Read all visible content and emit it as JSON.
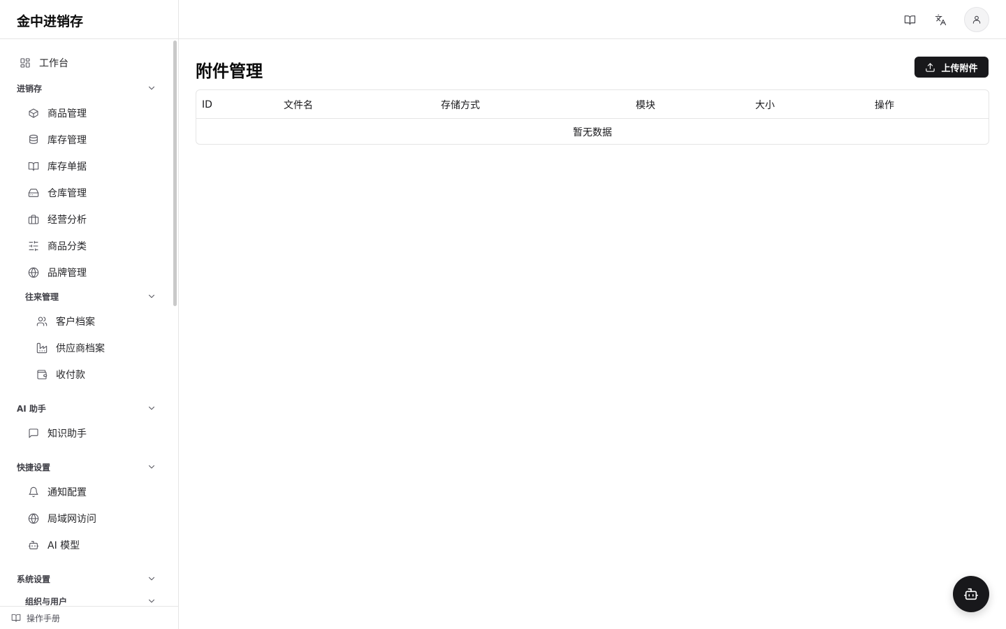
{
  "app": {
    "title": "金中进销存"
  },
  "sidebar": {
    "workbench": {
      "label": "工作台",
      "icon": "dashboard-icon"
    },
    "groups": {
      "jxc": {
        "label": "进销存",
        "items": [
          {
            "label": "商品管理",
            "icon": "package-icon"
          },
          {
            "label": "库存管理",
            "icon": "database-icon"
          },
          {
            "label": "库存单据",
            "icon": "book-open-icon"
          },
          {
            "label": "仓库管理",
            "icon": "warehouse-icon"
          },
          {
            "label": "经营分析",
            "icon": "briefcase-icon"
          },
          {
            "label": "商品分类",
            "icon": "sliders-icon"
          },
          {
            "label": "品牌管理",
            "icon": "globe-icon"
          }
        ],
        "sub": {
          "label": "往来管理",
          "items": [
            {
              "label": "客户档案",
              "icon": "users-icon"
            },
            {
              "label": "供应商档案",
              "icon": "factory-icon"
            },
            {
              "label": "收付款",
              "icon": "wallet-icon"
            }
          ]
        }
      },
      "ai": {
        "label": "AI 助手",
        "items": [
          {
            "label": "知识助手",
            "icon": "message-square-icon"
          }
        ]
      },
      "quick": {
        "label": "快捷设置",
        "items": [
          {
            "label": "通知配置",
            "icon": "bell-icon"
          },
          {
            "label": "局域网访问",
            "icon": "globe-icon"
          },
          {
            "label": "AI 模型",
            "icon": "bot-icon"
          }
        ]
      },
      "system": {
        "label": "系统设置",
        "sub": {
          "label": "组织与用户"
        }
      }
    },
    "footer": {
      "label": "操作手册",
      "icon": "book-open-icon"
    }
  },
  "header": {
    "icons": [
      "book-open-icon",
      "languages-icon",
      "user-icon"
    ]
  },
  "main": {
    "title": "附件管理",
    "upload_label": "上传附件",
    "table": {
      "columns": [
        "ID",
        "文件名",
        "存储方式",
        "模块",
        "大小",
        "操作"
      ],
      "empty_text": "暂无数据"
    }
  },
  "fab": {
    "icon": "bot-icon"
  }
}
